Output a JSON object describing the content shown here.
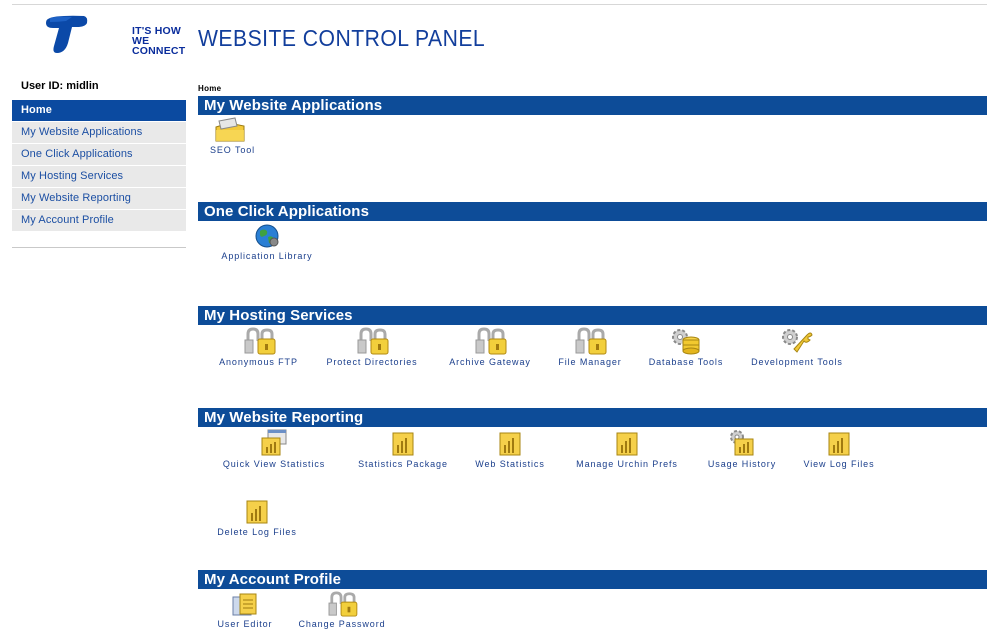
{
  "header": {
    "logo_tagline_line1": "IT'S HOW",
    "logo_tagline_line2": "WE CONNECT",
    "title": "WEBSITE CONTROL PANEL"
  },
  "sidebar": {
    "user_id": "User ID: midlin",
    "items": [
      {
        "label": "Home",
        "active": true
      },
      {
        "label": "My Website Applications"
      },
      {
        "label": "One Click Applications"
      },
      {
        "label": "My Hosting Services"
      },
      {
        "label": "My Website Reporting"
      },
      {
        "label": "My Account Profile"
      }
    ]
  },
  "main": {
    "breadcrumb": "Home",
    "sections": [
      {
        "title": "My Website Applications",
        "items": [
          {
            "label": "SEO Tool",
            "icon": "seo-tool-icon"
          }
        ]
      },
      {
        "title": "One Click Applications",
        "items": [
          {
            "label": "Application Library",
            "icon": "globe-icon"
          }
        ]
      },
      {
        "title": "My Hosting Services",
        "items": [
          {
            "label": "Anonymous FTP",
            "icon": "padlock-icon"
          },
          {
            "label": "Protect Directories",
            "icon": "padlock-icon"
          },
          {
            "label": "Archive Gateway",
            "icon": "padlock-icon"
          },
          {
            "label": "File Manager",
            "icon": "padlock-icon"
          },
          {
            "label": "Database Tools",
            "icon": "database-gear-icon"
          },
          {
            "label": "Development Tools",
            "icon": "wrench-icon"
          }
        ]
      },
      {
        "title": "My Website Reporting",
        "items": [
          {
            "label": "Quick View Statistics",
            "icon": "stats-window-icon"
          },
          {
            "label": "Statistics Package",
            "icon": "bar-chart-icon"
          },
          {
            "label": "Web Statistics",
            "icon": "bar-chart-icon"
          },
          {
            "label": "Manage Urchin Prefs",
            "icon": "bar-chart-icon"
          },
          {
            "label": "Usage History",
            "icon": "gear-chart-icon"
          },
          {
            "label": "View Log Files",
            "icon": "bar-chart-icon"
          },
          {
            "label": "Delete Log Files",
            "icon": "bar-chart-icon"
          }
        ]
      },
      {
        "title": "My Account Profile",
        "items": [
          {
            "label": "User Editor",
            "icon": "user-editor-icon"
          },
          {
            "label": "Change Password",
            "icon": "padlock-icon"
          }
        ]
      }
    ]
  },
  "colors": {
    "brand_blue": "#0d4c98",
    "nav_active": "#0b4aa0",
    "nav_bg": "#e9e9e9",
    "link_text": "#1b3f8c"
  }
}
